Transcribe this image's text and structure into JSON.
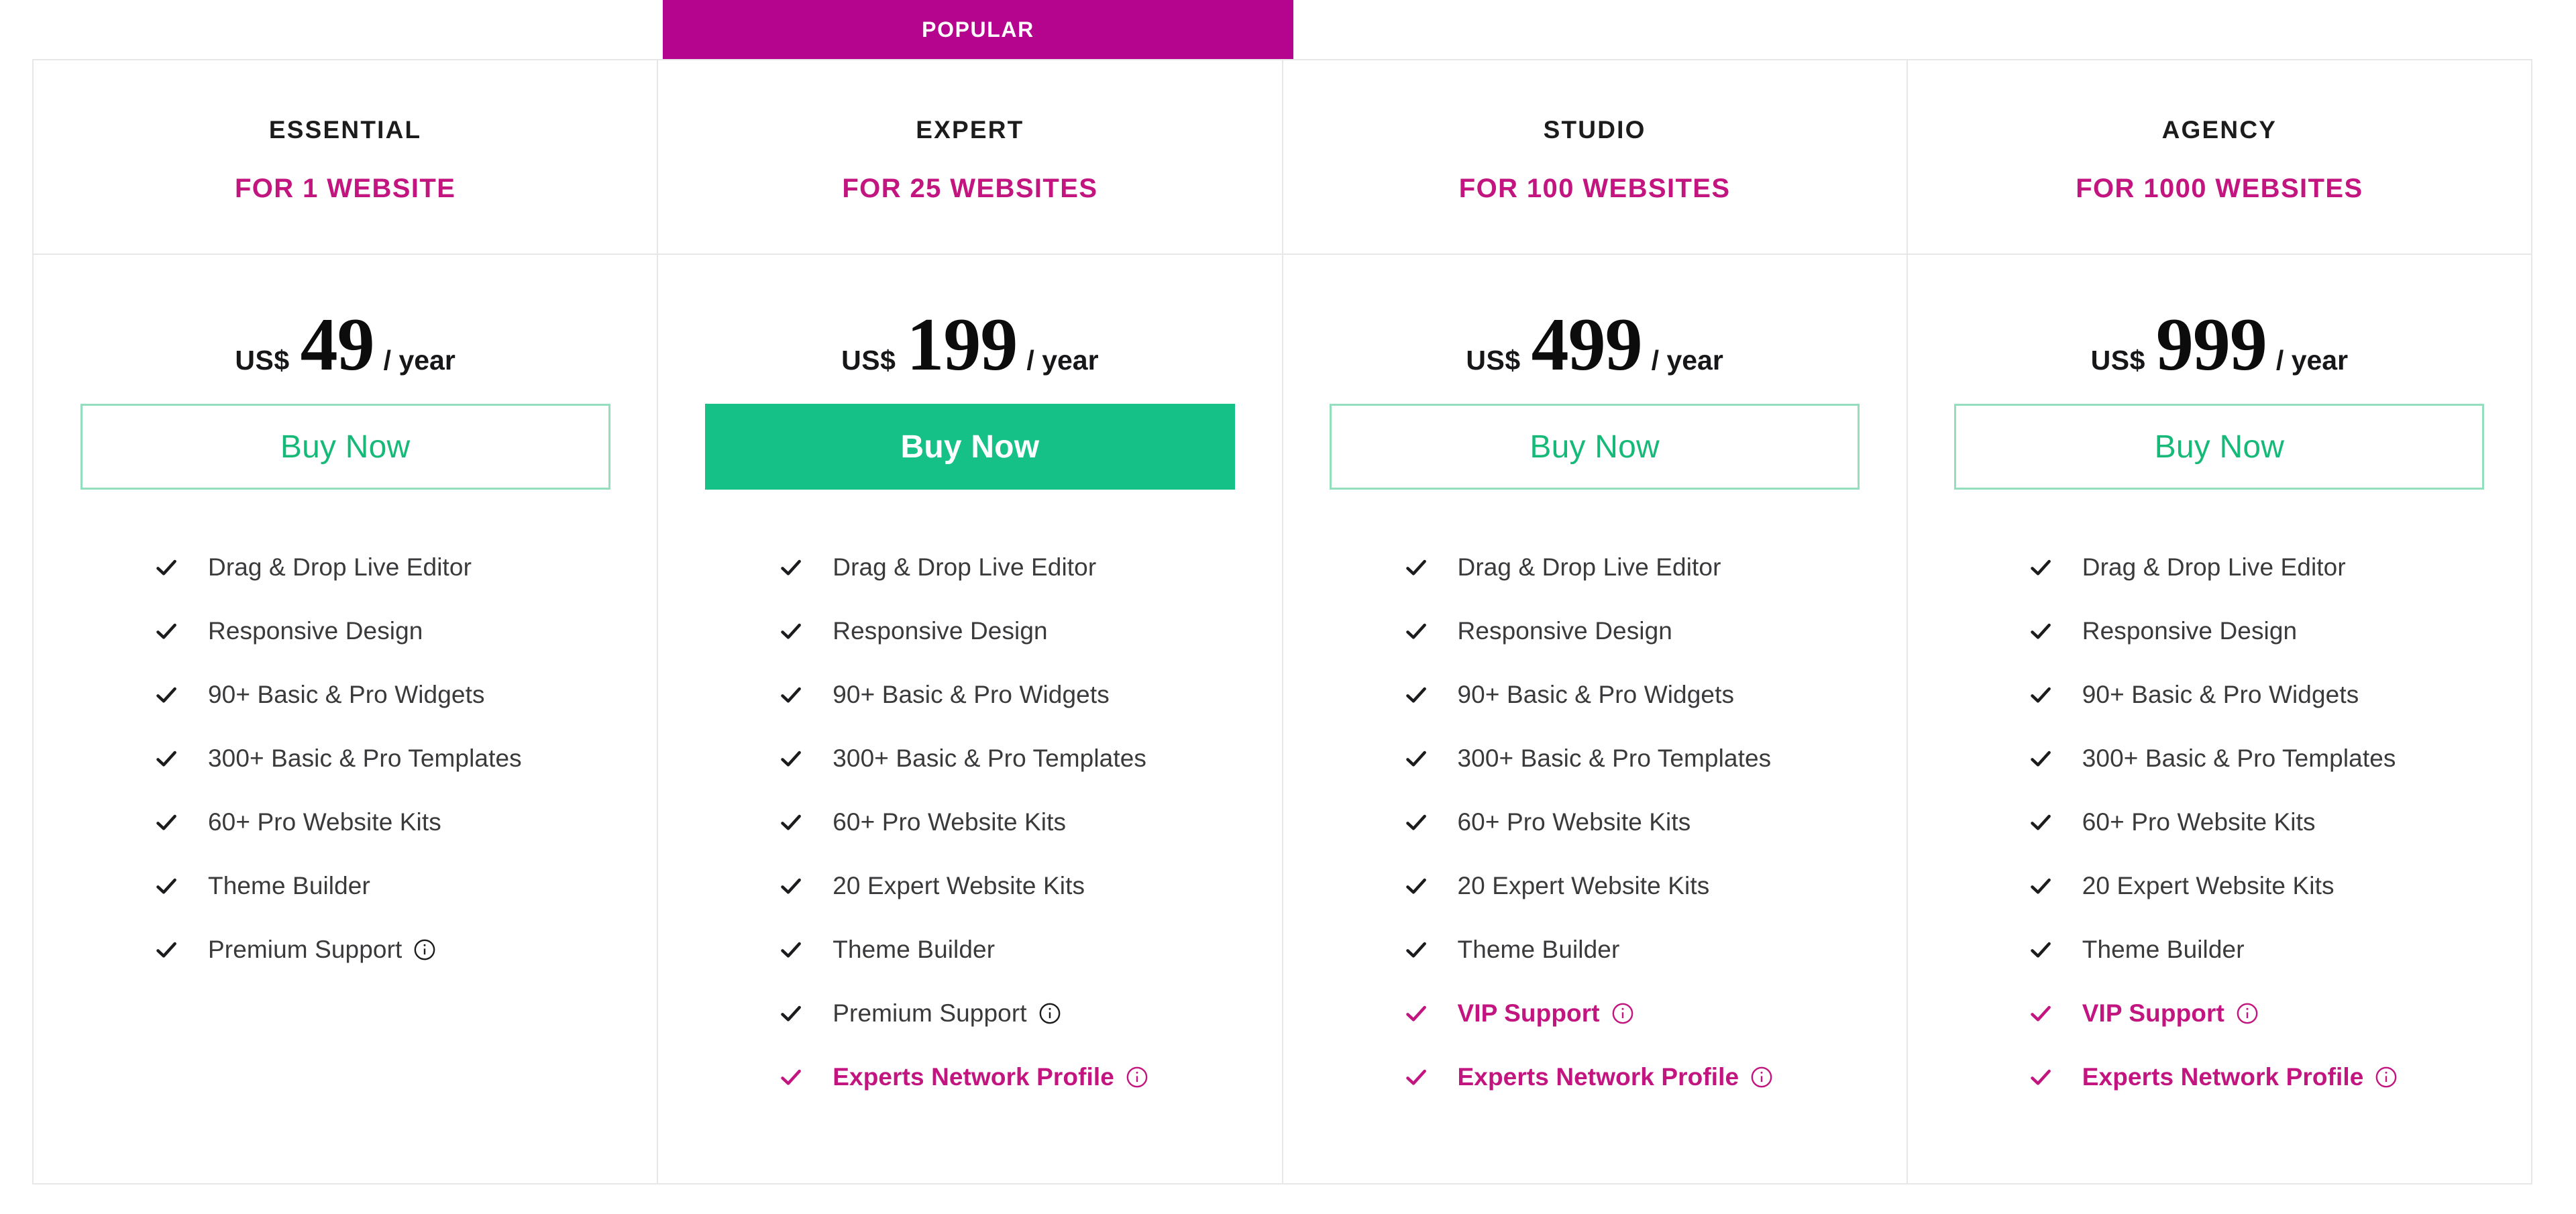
{
  "badge": {
    "popular_label": "POPULAR",
    "column_index": 1
  },
  "colors": {
    "accent_pink": "#c2157f",
    "badge_pink": "#b5048e",
    "green_solid": "#16c187",
    "green_outline_text": "#17b978",
    "green_outline_border": "#93dfbd",
    "border_gray": "#e7e7e7",
    "text_dark": "#3a3a3c",
    "plan_name": "#1c1c1c"
  },
  "currency": "US$",
  "period": "/ year",
  "buy_label": "Buy Now",
  "icons": {
    "check": "check-icon",
    "info": "info-circle-icon"
  },
  "plans": [
    {
      "name": "ESSENTIAL",
      "scope": "FOR 1 WEBSITE",
      "price": "49",
      "currency": "US$",
      "period": "/ year",
      "buy_label": "Buy Now",
      "button_style": "outline",
      "popular": false,
      "features": [
        {
          "label": "Drag & Drop Live Editor",
          "highlight": false,
          "info": false
        },
        {
          "label": "Responsive Design",
          "highlight": false,
          "info": false
        },
        {
          "label": "90+ Basic & Pro Widgets",
          "highlight": false,
          "info": false
        },
        {
          "label": "300+ Basic & Pro Templates",
          "highlight": false,
          "info": false
        },
        {
          "label": "60+ Pro Website Kits",
          "highlight": false,
          "info": false
        },
        {
          "label": "Theme Builder",
          "highlight": false,
          "info": false
        },
        {
          "label": "Premium Support",
          "highlight": false,
          "info": true
        }
      ]
    },
    {
      "name": "EXPERT",
      "scope": "FOR 25 WEBSITES",
      "price": "199",
      "currency": "US$",
      "period": "/ year",
      "buy_label": "Buy Now",
      "button_style": "solid",
      "popular": true,
      "features": [
        {
          "label": "Drag & Drop Live Editor",
          "highlight": false,
          "info": false
        },
        {
          "label": "Responsive Design",
          "highlight": false,
          "info": false
        },
        {
          "label": "90+ Basic & Pro Widgets",
          "highlight": false,
          "info": false
        },
        {
          "label": "300+ Basic & Pro Templates",
          "highlight": false,
          "info": false
        },
        {
          "label": "60+ Pro Website Kits",
          "highlight": false,
          "info": false
        },
        {
          "label": "20 Expert Website Kits",
          "highlight": false,
          "info": false
        },
        {
          "label": "Theme Builder",
          "highlight": false,
          "info": false
        },
        {
          "label": "Premium Support",
          "highlight": false,
          "info": true
        },
        {
          "label": "Experts Network Profile",
          "highlight": true,
          "info": true
        }
      ]
    },
    {
      "name": "STUDIO",
      "scope": "FOR 100 WEBSITES",
      "price": "499",
      "currency": "US$",
      "period": "/ year",
      "buy_label": "Buy Now",
      "button_style": "outline",
      "popular": false,
      "features": [
        {
          "label": "Drag & Drop Live Editor",
          "highlight": false,
          "info": false
        },
        {
          "label": "Responsive Design",
          "highlight": false,
          "info": false
        },
        {
          "label": "90+ Basic & Pro Widgets",
          "highlight": false,
          "info": false
        },
        {
          "label": "300+ Basic & Pro Templates",
          "highlight": false,
          "info": false
        },
        {
          "label": "60+ Pro Website Kits",
          "highlight": false,
          "info": false
        },
        {
          "label": "20 Expert Website Kits",
          "highlight": false,
          "info": false
        },
        {
          "label": "Theme Builder",
          "highlight": false,
          "info": false
        },
        {
          "label": "VIP Support",
          "highlight": true,
          "info": true
        },
        {
          "label": "Experts Network Profile",
          "highlight": true,
          "info": true
        }
      ]
    },
    {
      "name": "AGENCY",
      "scope": "FOR 1000 WEBSITES",
      "price": "999",
      "currency": "US$",
      "period": "/ year",
      "buy_label": "Buy Now",
      "button_style": "outline",
      "popular": false,
      "features": [
        {
          "label": "Drag & Drop Live Editor",
          "highlight": false,
          "info": false
        },
        {
          "label": "Responsive Design",
          "highlight": false,
          "info": false
        },
        {
          "label": "90+ Basic & Pro Widgets",
          "highlight": false,
          "info": false
        },
        {
          "label": "300+ Basic & Pro Templates",
          "highlight": false,
          "info": false
        },
        {
          "label": "60+ Pro Website Kits",
          "highlight": false,
          "info": false
        },
        {
          "label": "20 Expert Website Kits",
          "highlight": false,
          "info": false
        },
        {
          "label": "Theme Builder",
          "highlight": false,
          "info": false
        },
        {
          "label": "VIP Support",
          "highlight": true,
          "info": true
        },
        {
          "label": "Experts Network Profile",
          "highlight": true,
          "info": true
        }
      ]
    }
  ]
}
